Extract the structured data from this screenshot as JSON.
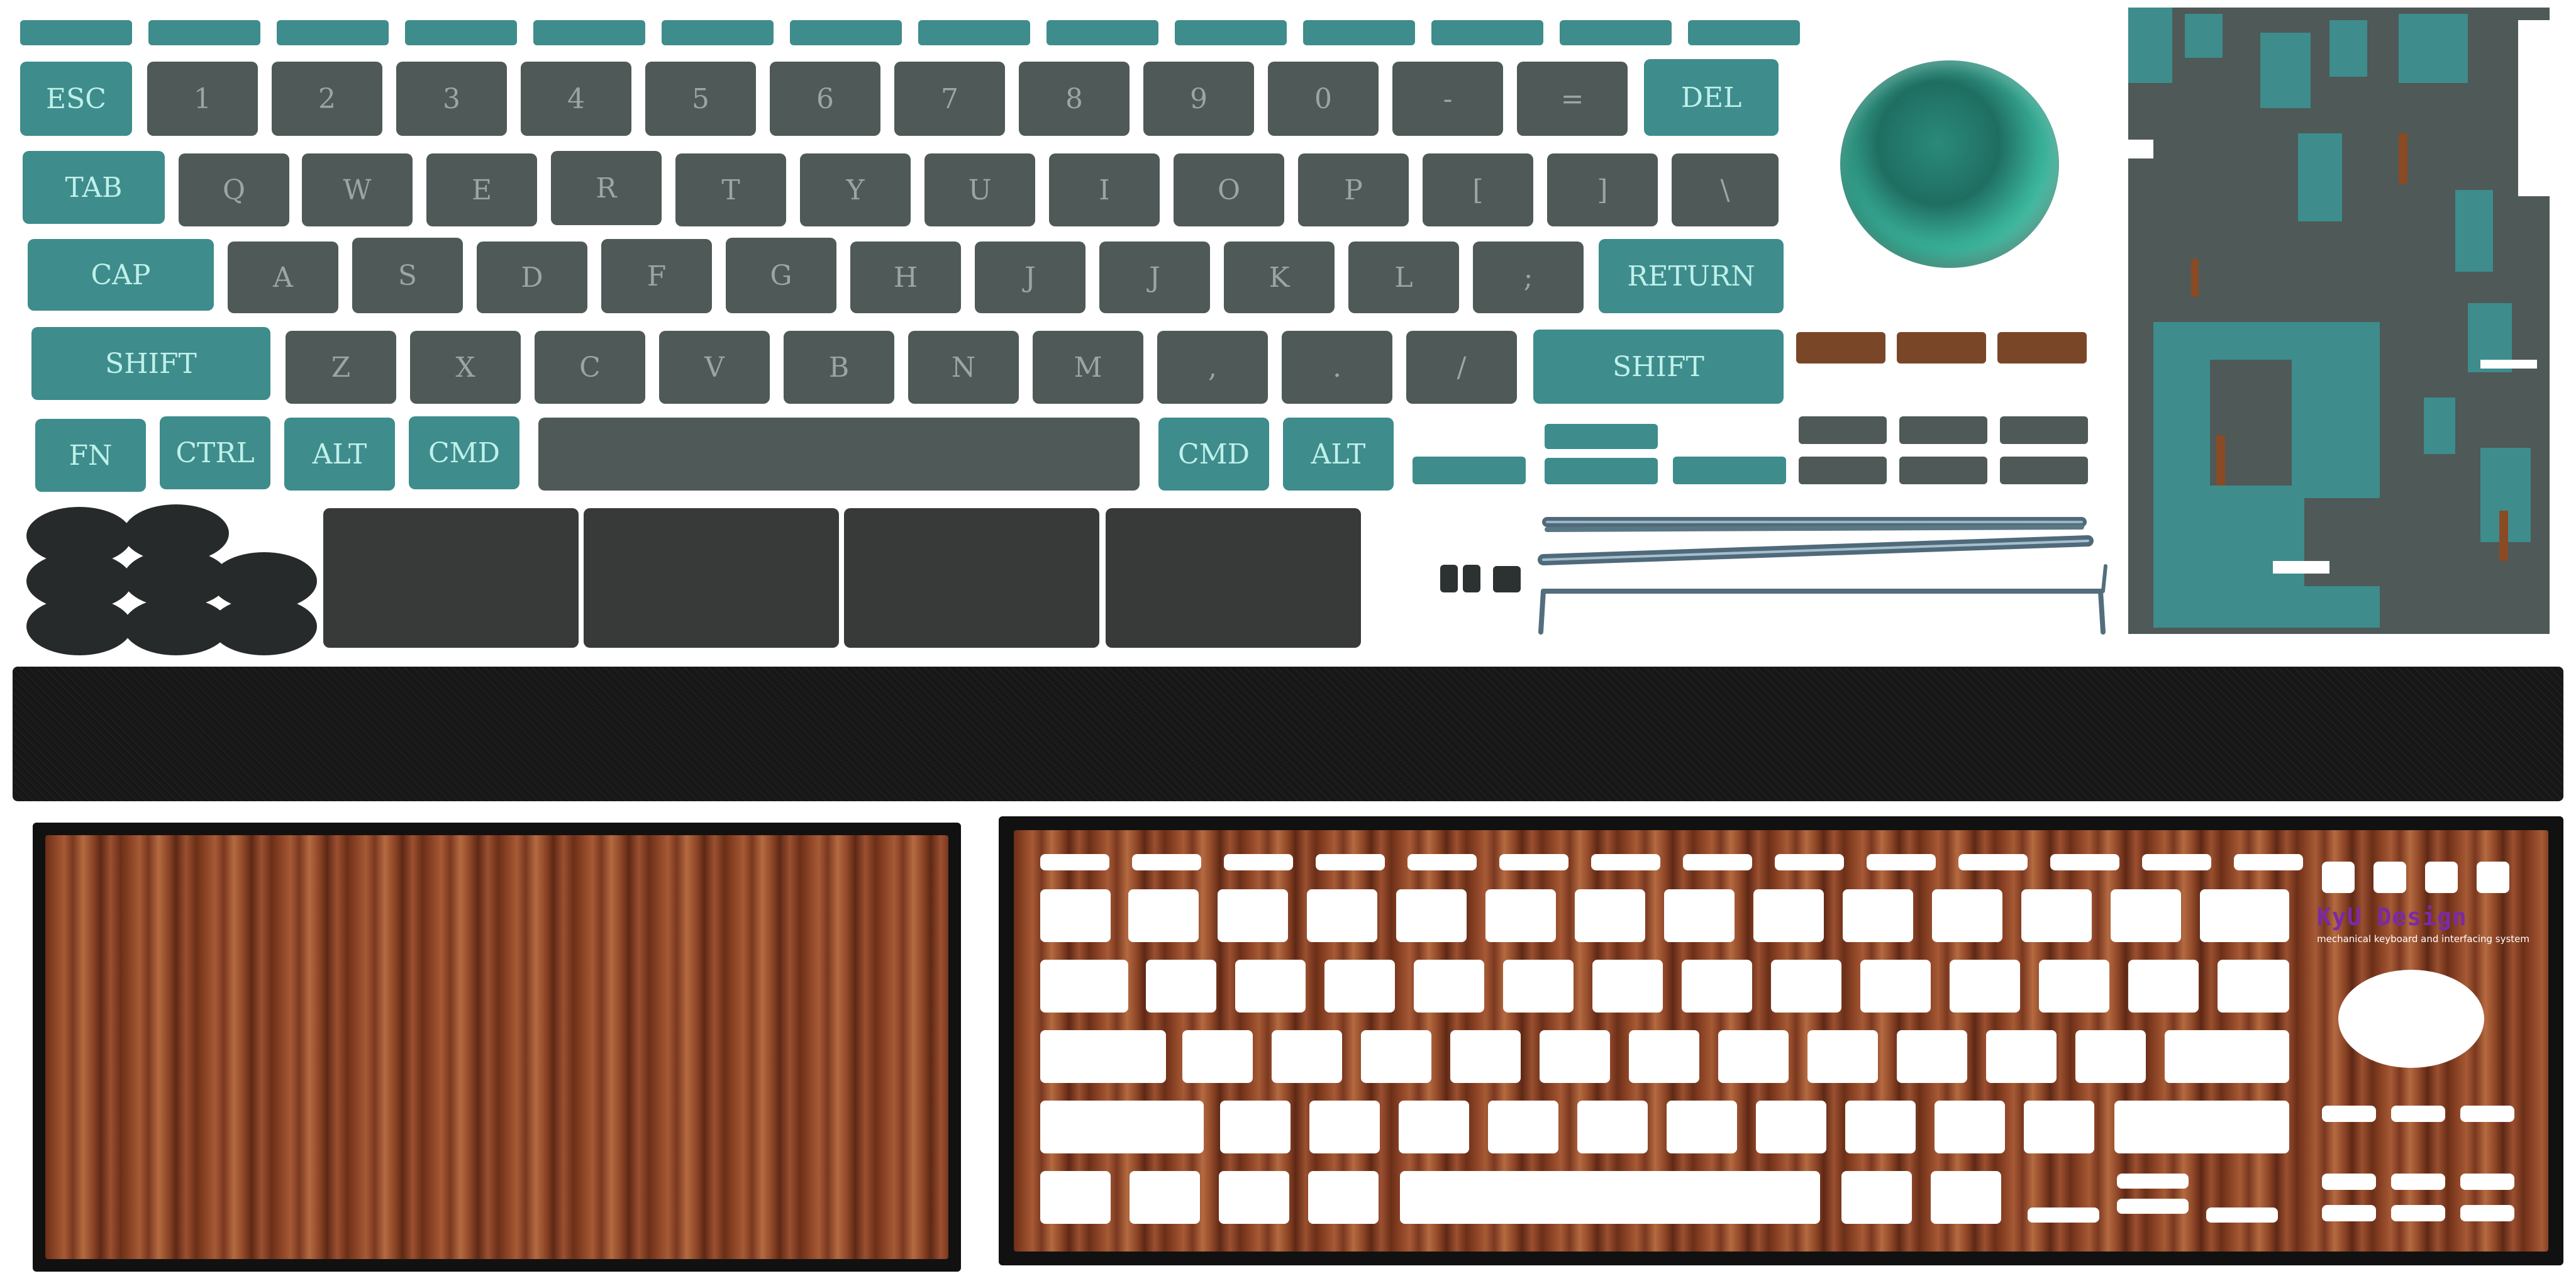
{
  "keyboard": {
    "row1": [
      "ESC",
      "1",
      "2",
      "3",
      "4",
      "5",
      "6",
      "7",
      "8",
      "9",
      "0",
      "-",
      "=",
      "DEL"
    ],
    "row2": [
      "TAB",
      "Q",
      "W",
      "E",
      "R",
      "T",
      "Y",
      "U",
      "I",
      "O",
      "P",
      "[",
      "]",
      "\\"
    ],
    "row3": [
      "CAP",
      "A",
      "S",
      "D",
      "F",
      "G",
      "H",
      "J",
      "J",
      "K",
      "L",
      ";",
      "RETURN"
    ],
    "row4": [
      "SHIFT",
      "Z",
      "X",
      "C",
      "V",
      "B",
      "N",
      "M",
      ",",
      ".",
      "/",
      "SHIFT"
    ],
    "row5": [
      "FN",
      "CTRL",
      "ALT",
      "CMD",
      "",
      "CMD",
      "ALT"
    ]
  },
  "brand": {
    "name": "KyU Design",
    "tagline": "mechanical keyboard and interfacing system"
  },
  "colors": {
    "teal": "#3e8c8c",
    "gray": "#4e5958",
    "brown": "#7a4628",
    "dark": "#1a1a1a",
    "legend_teal": "#bff0ea",
    "legend_gray": "#9aa6a4"
  }
}
